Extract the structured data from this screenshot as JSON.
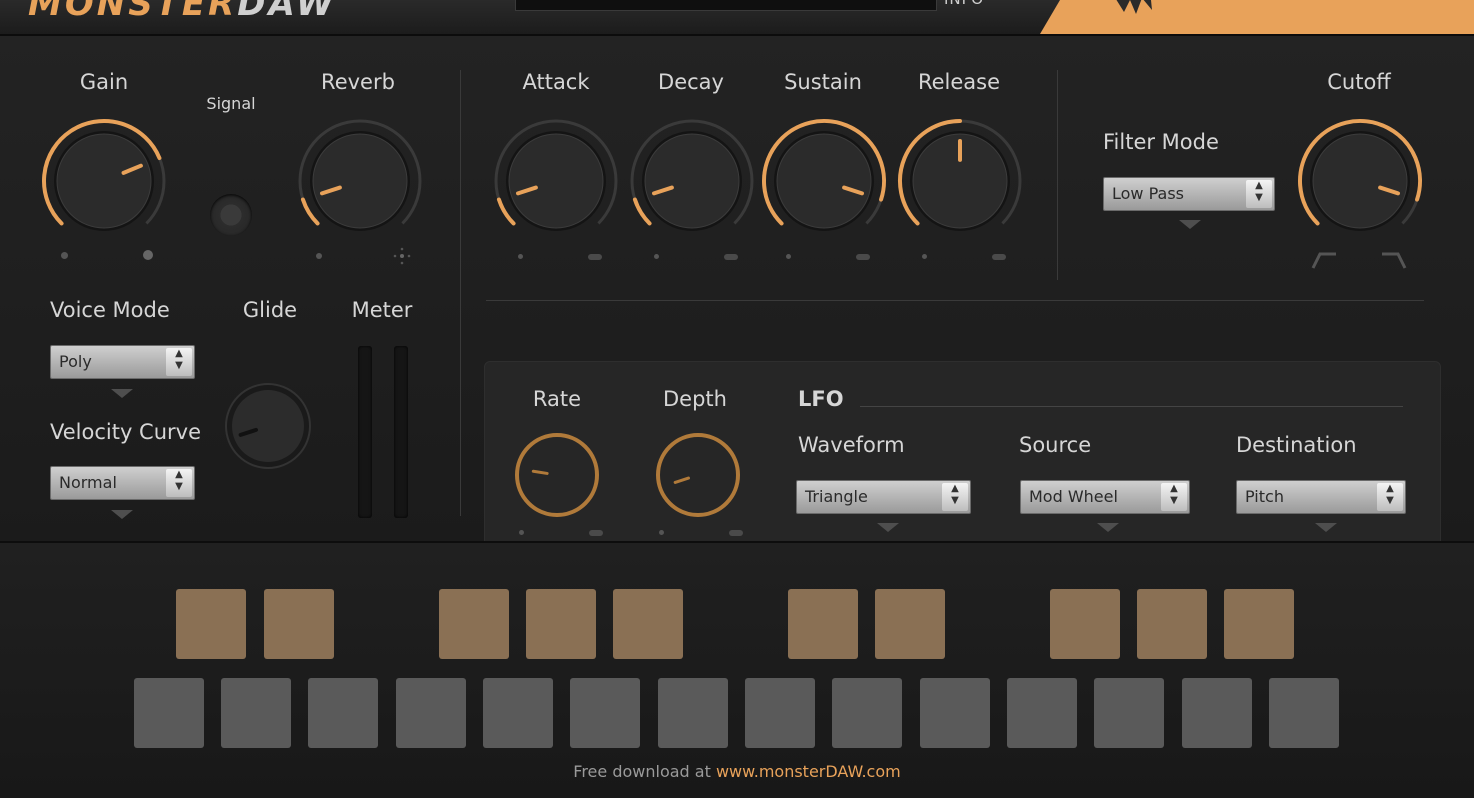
{
  "header": {
    "logo_primary": "MONSTER",
    "logo_secondary": "DAW",
    "info_label": "INFO",
    "brand_icon": "monster-logo-icon"
  },
  "colors": {
    "accent": "#e8a25a",
    "panel": "#1f1f1f",
    "pad_black": "#8a7054",
    "pad_white": "#5a5a5a"
  },
  "main": {
    "gain_label": "Gain",
    "signal_label": "Signal",
    "reverb_label": "Reverb",
    "voice_mode_label": "Voice Mode",
    "voice_mode_value": "Poly",
    "velocity_curve_label": "Velocity Curve",
    "velocity_curve_value": "Normal",
    "glide_label": "Glide",
    "meter_label": "Meter",
    "attack_label": "Attack",
    "decay_label": "Decay",
    "sustain_label": "Sustain",
    "release_label": "Release",
    "filter_mode_label": "Filter Mode",
    "filter_mode_value": "Low Pass",
    "cutoff_label": "Cutoff"
  },
  "knob_levels": {
    "gain": 0.75,
    "reverb": 0.1,
    "attack": 0.1,
    "decay": 0.1,
    "sustain": 0.9,
    "release": 0.5,
    "cutoff": 0.9,
    "glide": 0.1,
    "rate": 0.2,
    "depth": 0.1
  },
  "lfo": {
    "title": "LFO",
    "rate_label": "Rate",
    "depth_label": "Depth",
    "waveform_label": "Waveform",
    "waveform_value": "Triangle",
    "source_label": "Source",
    "source_value": "Mod Wheel",
    "destination_label": "Destination",
    "destination_value": "Pitch"
  },
  "keyboard": {
    "black_pad_count": 10,
    "white_pad_count": 14
  },
  "footer": {
    "prefix": "Free download at ",
    "url": "www.monsterDAW.com"
  }
}
